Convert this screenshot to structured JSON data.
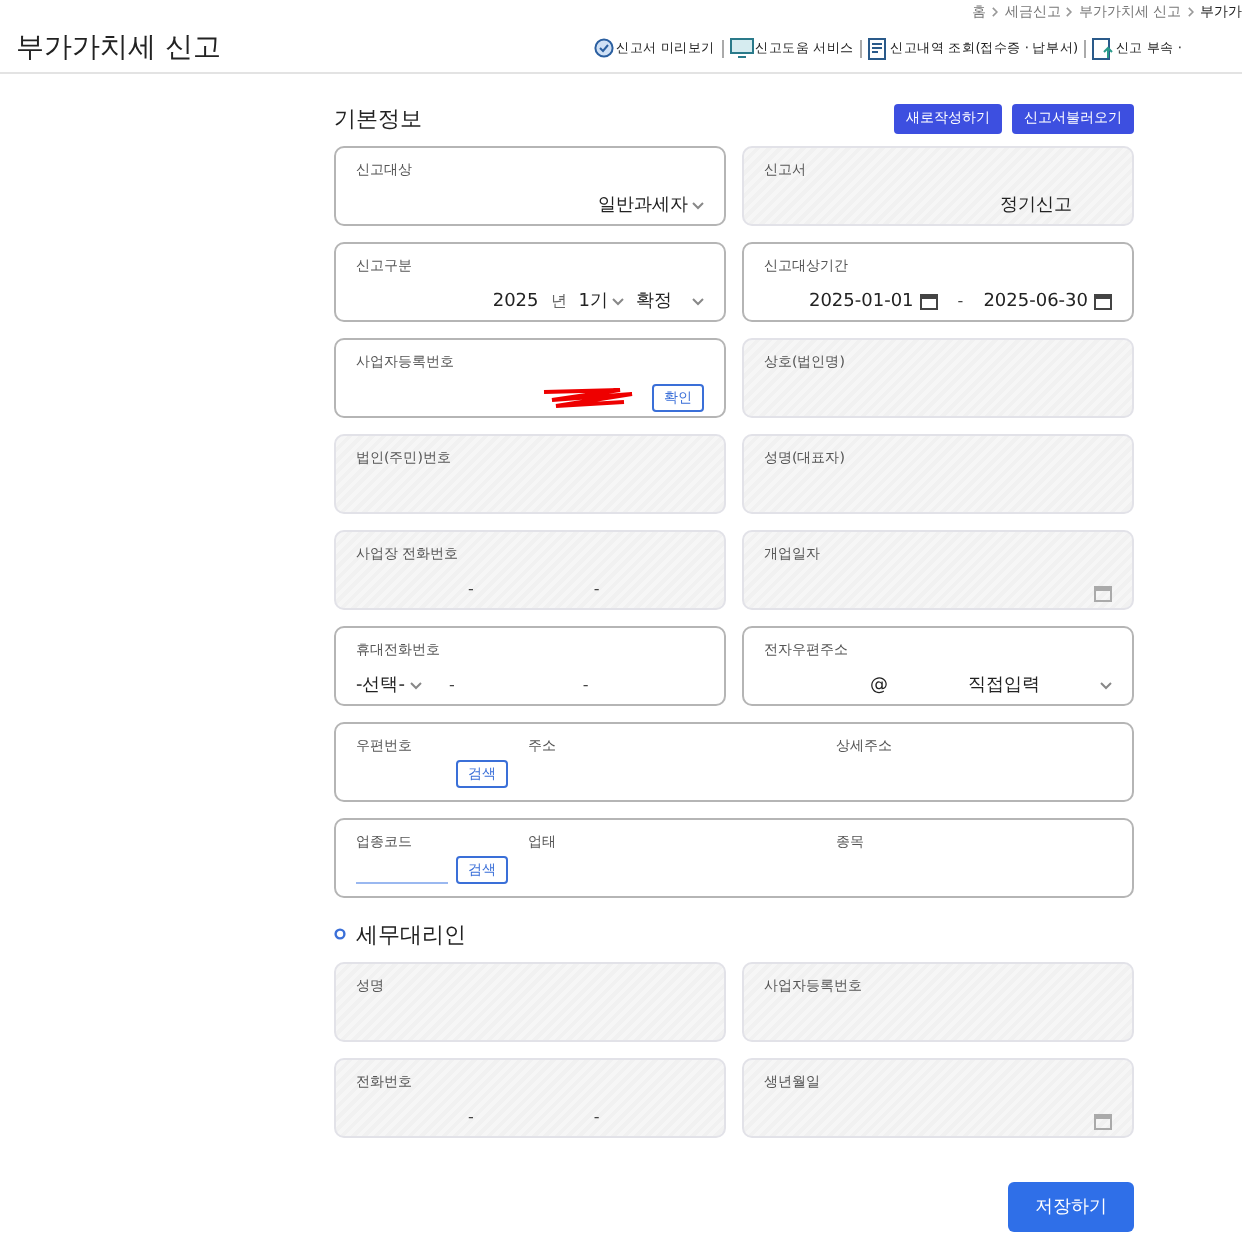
{
  "breadcrumb": [
    "홈",
    "세금신고",
    "부가가치세 신고",
    "부가가"
  ],
  "title": "부가가치세 신고",
  "nav": [
    {
      "label": "신고서 미리보기"
    },
    {
      "label": "신고도움 서비스"
    },
    {
      "label": "신고내역 조회(접수증 · 납부서)"
    },
    {
      "label": "신고 부속 ·"
    }
  ],
  "sections": [
    {
      "title": "기본정보",
      "kind": "heading",
      "buttons": [
        "새로작성하기",
        "신고서불러오기"
      ],
      "rows": [
        {
          "cards": [
            {
              "kind": "select",
              "label": "신고대상",
              "value": "일반과세자",
              "disabled": false
            },
            {
              "kind": "text",
              "label": "신고서",
              "value": "정기신고",
              "disabled": true
            }
          ]
        },
        {
          "cards": [
            {
              "kind": "report_type",
              "label": "신고구분",
              "year": "2025",
              "unit": "년",
              "term": "1기",
              "status": "확정",
              "disabled": false
            },
            {
              "kind": "period",
              "label": "신고대상기간",
              "start": "2025-01-01",
              "sep": "-",
              "end": "2025-06-30",
              "disabled": false
            }
          ]
        },
        {
          "cards": [
            {
              "kind": "confirm",
              "label": "사업자등록번호",
              "button": "확인",
              "disabled": false
            },
            {
              "kind": "text",
              "label": "상호(법인명)",
              "disabled": true
            }
          ]
        },
        {
          "cards": [
            {
              "kind": "text",
              "label": "법인(주민)번호",
              "disabled": true
            },
            {
              "kind": "text",
              "label": "성명(대표자)",
              "disabled": true
            }
          ]
        },
        {
          "cards": [
            {
              "kind": "phone",
              "label": "사업장 전화번호",
              "dashes": [
                "-",
                "-"
              ],
              "disabled": true
            },
            {
              "kind": "date",
              "label": "개업일자",
              "disabled": true
            }
          ]
        },
        {
          "cards": [
            {
              "kind": "mobile",
              "label": "휴대전화번호",
              "select": "-선택-",
              "dashes": [
                "-",
                "-"
              ],
              "disabled": false
            },
            {
              "kind": "email",
              "label": "전자우편주소",
              "at": "@",
              "select": "직접입력",
              "disabled": false
            }
          ]
        },
        {
          "cards": [
            {
              "kind": "multi",
              "disabled": false,
              "columns": [
                {
                  "label": "우편번호",
                  "button": "검색",
                  "input": false
                },
                {
                  "label": "주소"
                },
                {
                  "label": "상세주소"
                }
              ]
            }
          ]
        },
        {
          "cards": [
            {
              "kind": "multi",
              "disabled": false,
              "columns": [
                {
                  "label": "업종코드",
                  "button": "검색",
                  "input": true
                },
                {
                  "label": "업태"
                },
                {
                  "label": "종목"
                }
              ]
            }
          ]
        }
      ]
    },
    {
      "title": "세무대리인",
      "kind": "bullet",
      "rows": [
        {
          "cards": [
            {
              "kind": "text",
              "label": "성명",
              "disabled": true
            },
            {
              "kind": "text",
              "label": "사업자등록번호",
              "disabled": true
            }
          ]
        },
        {
          "cards": [
            {
              "kind": "phone",
              "label": "전화번호",
              "dashes": [
                "-",
                "-"
              ],
              "disabled": true
            },
            {
              "kind": "date",
              "label": "생년월일",
              "disabled": true
            }
          ]
        }
      ]
    }
  ],
  "save": "저장하기"
}
